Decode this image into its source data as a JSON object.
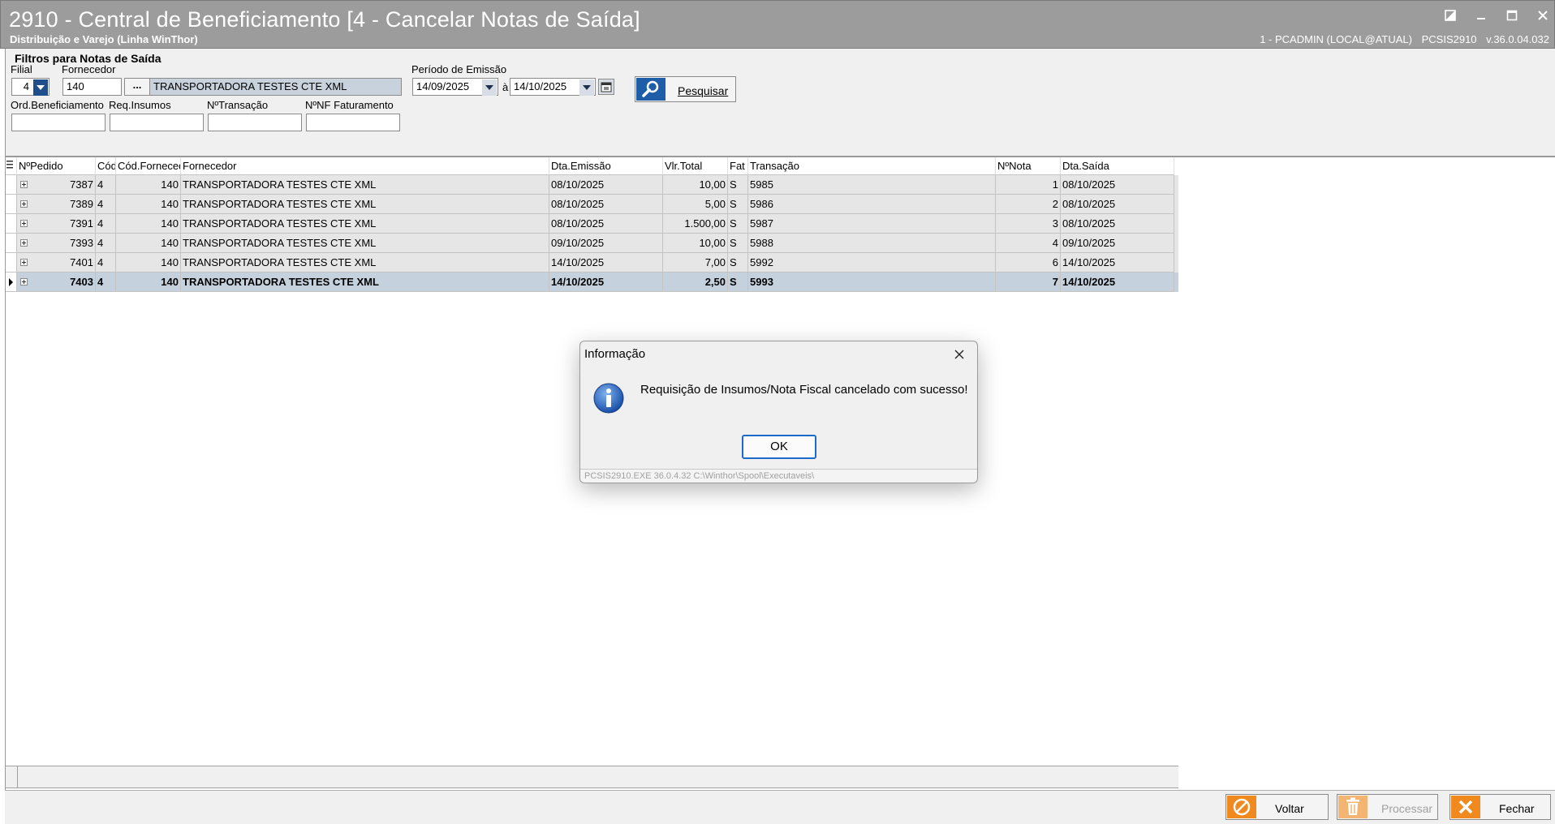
{
  "window": {
    "title": "2910 - Central de Beneficiamento [4 - Cancelar Notas de Saída]",
    "subtitle": "Distribuição e Varejo (Linha WinThor)",
    "user_info": "1 - PCADMIN (LOCAL@ATUAL)",
    "module": "PCSIS2910",
    "version": "v.36.0.04.032"
  },
  "filters": {
    "title": "Filtros para Notas de Saída",
    "filial_label": "Filial",
    "filial_value": "4",
    "fornecedor_label": "Fornecedor",
    "fornecedor_code": "140",
    "fornecedor_lookup_btn": "...",
    "fornecedor_name": "TRANSPORTADORA TESTES CTE XML",
    "periodo_label": "Período de Emissão",
    "date_from": "14/09/2025",
    "date_sep": "à",
    "date_to": "14/10/2025",
    "pesquisar_label": "Pesquisar",
    "ord_benef_label": "Ord.Beneficiamento",
    "req_insumos_label": "Req.Insumos",
    "ntransacao_label": "NºTransação",
    "nnf_fat_label": "NºNF Faturamento",
    "ord_benef_value": "",
    "req_insumos_value": "",
    "ntransacao_value": "",
    "nnf_fat_value": ""
  },
  "grid": {
    "headers": [
      "NºPedido",
      "Cód",
      "Cód.Fornecedor",
      "Fornecedor",
      "Dta.Emissão",
      "Vlr.Total",
      "Fat",
      "Transação",
      "NºNota",
      "Dta.Saída"
    ],
    "rows": [
      {
        "pedido": "7387",
        "cod": "4",
        "codforn": "140",
        "fornecedor": "TRANSPORTADORA TESTES CTE XML",
        "emissao": "08/10/2025",
        "total": "10,00",
        "fat": "S",
        "transacao": "5985",
        "nota": "1",
        "saida": "08/10/2025"
      },
      {
        "pedido": "7389",
        "cod": "4",
        "codforn": "140",
        "fornecedor": "TRANSPORTADORA TESTES CTE XML",
        "emissao": "08/10/2025",
        "total": "5,00",
        "fat": "S",
        "transacao": "5986",
        "nota": "2",
        "saida": "08/10/2025"
      },
      {
        "pedido": "7391",
        "cod": "4",
        "codforn": "140",
        "fornecedor": "TRANSPORTADORA TESTES CTE XML",
        "emissao": "08/10/2025",
        "total": "1.500,00",
        "fat": "S",
        "transacao": "5987",
        "nota": "3",
        "saida": "08/10/2025"
      },
      {
        "pedido": "7393",
        "cod": "4",
        "codforn": "140",
        "fornecedor": "TRANSPORTADORA TESTES CTE XML",
        "emissao": "09/10/2025",
        "total": "10,00",
        "fat": "S",
        "transacao": "5988",
        "nota": "4",
        "saida": "09/10/2025"
      },
      {
        "pedido": "7401",
        "cod": "4",
        "codforn": "140",
        "fornecedor": "TRANSPORTADORA TESTES CTE XML",
        "emissao": "14/10/2025",
        "total": "7,00",
        "fat": "S",
        "transacao": "5992",
        "nota": "6",
        "saida": "14/10/2025"
      },
      {
        "pedido": "7403",
        "cod": "4",
        "codforn": "140",
        "fornecedor": "TRANSPORTADORA TESTES CTE XML",
        "emissao": "14/10/2025",
        "total": "2,50",
        "fat": "S",
        "transacao": "5993",
        "nota": "7",
        "saida": "14/10/2025"
      }
    ],
    "selected_row_index": 5
  },
  "buttons": {
    "voltar": "Voltar",
    "processar": "Processar",
    "fechar": "Fechar"
  },
  "dialog": {
    "title": "Informação",
    "message": "Requisição de Insumos/Nota Fiscal cancelado com sucesso!",
    "ok_label": "OK",
    "footer": "PCSIS2910.EXE 36.0.4.32 C:\\Winthor\\Spool\\Executaveis\\"
  },
  "colors": {
    "titlebar": "#9c9c9c",
    "accent_blue": "#1e5ea8",
    "button_orange": "#f08a1e",
    "selected_row": "#c5d1dd"
  }
}
